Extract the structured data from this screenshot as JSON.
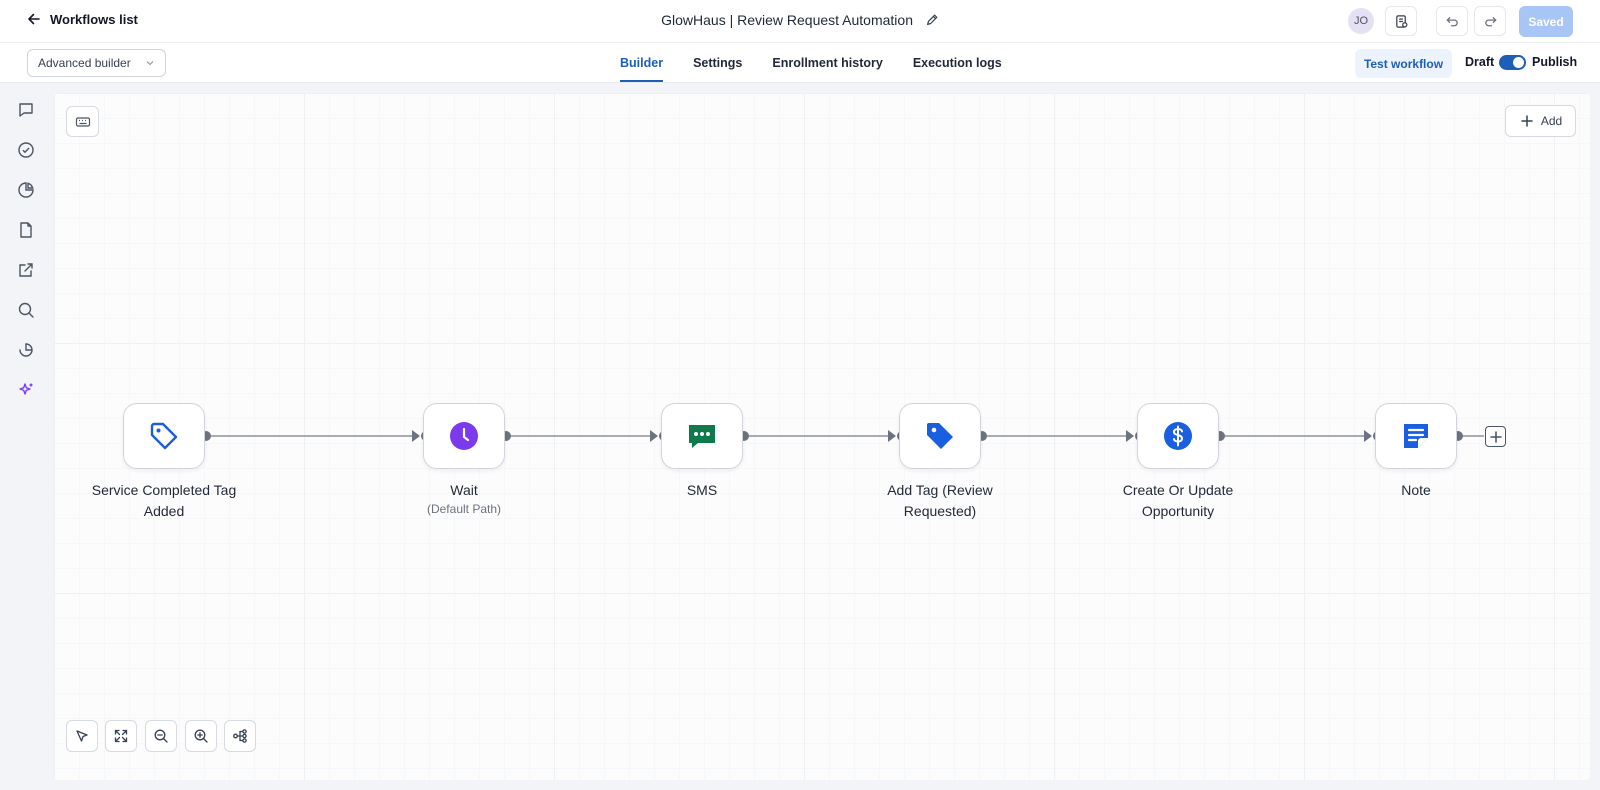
{
  "header": {
    "back_label": "Workflows list",
    "title": "GlowHaus | Review Request Automation",
    "avatar_initials": "JO",
    "saved_label": "Saved"
  },
  "subbar": {
    "builder_mode": "Advanced builder",
    "tabs": [
      {
        "label": "Builder",
        "active": true
      },
      {
        "label": "Settings",
        "active": false
      },
      {
        "label": "Enrollment history",
        "active": false
      },
      {
        "label": "Execution logs",
        "active": false
      }
    ],
    "test_label": "Test workflow",
    "draft_label": "Draft",
    "publish_label": "Publish"
  },
  "canvas": {
    "add_label": "Add",
    "nodes": [
      {
        "label": "Service Completed Tag Added",
        "sublabel": "",
        "icon": "tag-outline-icon",
        "color": "#1d5fd1"
      },
      {
        "label": "Wait",
        "sublabel": "(Default Path)",
        "icon": "clock-icon",
        "color": "#7c3aed"
      },
      {
        "label": "SMS",
        "sublabel": "",
        "icon": "chat-bubble-icon",
        "color": "#0f7a4b"
      },
      {
        "label": "Add Tag (Review Requested)",
        "sublabel": "",
        "icon": "tag-icon",
        "color": "#1a5fe0"
      },
      {
        "label": "Create Or Update Opportunity",
        "sublabel": "",
        "icon": "dollar-icon",
        "color": "#1a5fe0"
      },
      {
        "label": "Note",
        "sublabel": "",
        "icon": "note-icon",
        "color": "#1a5fe0"
      }
    ]
  }
}
